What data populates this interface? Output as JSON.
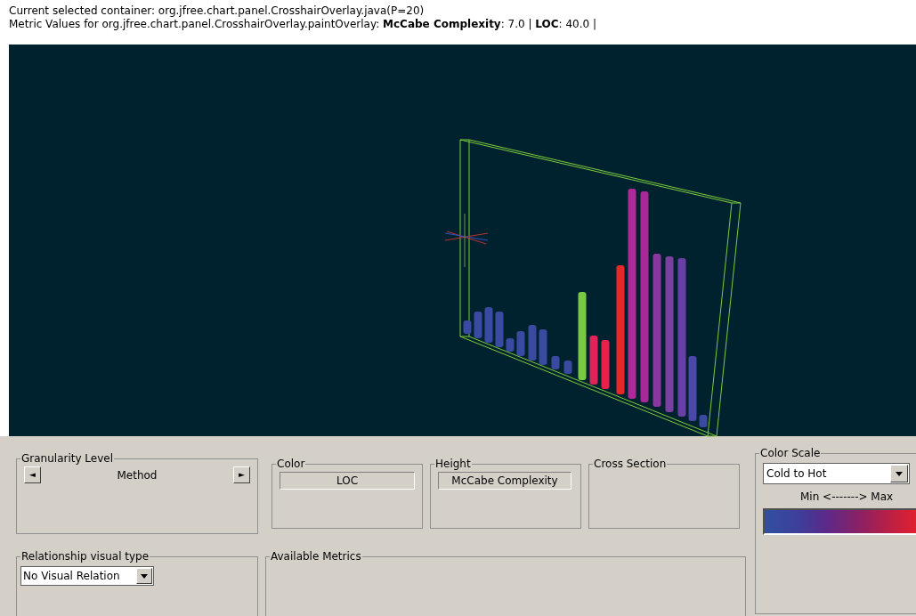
{
  "header": {
    "container_line": "Current selected container: org.jfree.chart.panel.CrosshairOverlay.java(P=20)",
    "metric_line": "Metric Values for org.jfree.chart.panel.CrosshairOverlay.paintOverlay: **McCabe Complexity**: 7.0 | **LOC**: 40.0 |"
  },
  "granularity": {
    "title": "Granularity Level",
    "value": "Method",
    "prev": "◄",
    "next": "►"
  },
  "color": {
    "title": "Color",
    "value": "LOC"
  },
  "height": {
    "title": "Height",
    "value": "McCabe Complexity"
  },
  "cross_section": {
    "title": "Cross Section"
  },
  "color_scale": {
    "title": "Color Scale",
    "value": "Cold to Hot",
    "legend": "Min <-------> Max"
  },
  "relationship": {
    "title": "Relationship visual type",
    "value": "No Visual Relation"
  },
  "available_metrics": {
    "title": "Available Metrics"
  }
}
